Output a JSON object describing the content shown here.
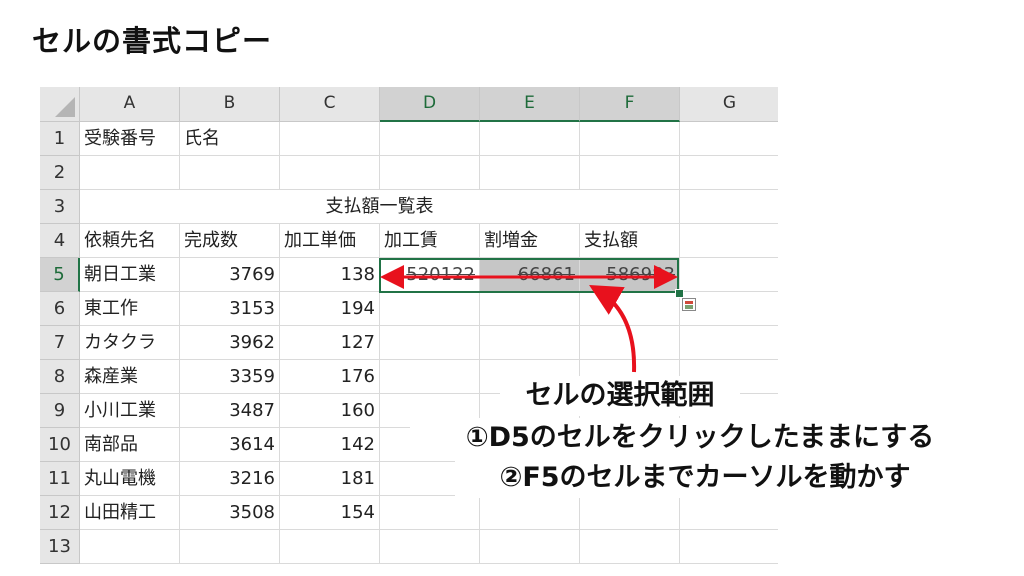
{
  "title": "セルの書式コピー",
  "sheet": {
    "columns": [
      "A",
      "B",
      "C",
      "D",
      "E",
      "F",
      "G"
    ],
    "rows": [
      "1",
      "2",
      "3",
      "4",
      "5",
      "6",
      "7",
      "8",
      "9",
      "10",
      "11",
      "12",
      "13"
    ],
    "selected_columns": [
      "D",
      "E",
      "F"
    ],
    "selected_row": "5",
    "cells": {
      "r1": {
        "A": "受験番号",
        "B": "氏名"
      },
      "r3": {
        "merged": "支払額一覧表"
      },
      "r4": {
        "A": "依頼先名",
        "B": "完成数",
        "C": "加工単価",
        "D": "加工賃",
        "E": "割増金",
        "F": "支払額"
      },
      "r5": {
        "A": "朝日工業",
        "B": "3769",
        "C": "138",
        "D": "520122",
        "E": "66861",
        "F": "586983"
      },
      "r6": {
        "A": "東工作",
        "B": "3153",
        "C": "194"
      },
      "r7": {
        "A": "カタクラ",
        "B": "3962",
        "C": "127"
      },
      "r8": {
        "A": "森産業",
        "B": "3359",
        "C": "176"
      },
      "r9": {
        "A": "小川工業",
        "B": "3487",
        "C": "160"
      },
      "r10": {
        "A": "南部品",
        "B": "3614",
        "C": "142"
      },
      "r11": {
        "A": "丸山電機",
        "B": "3216",
        "C": "181"
      },
      "r12": {
        "A": "山田精工",
        "B": "3508",
        "C": "154"
      }
    }
  },
  "annotations": {
    "heading": "セルの選択範囲",
    "step1": "①D5のセルをクリックしたままにする",
    "step2": "②F5のセルまでカーソルを動かす"
  },
  "colors": {
    "selection_border": "#217346",
    "arrow": "#e8111d",
    "header_bg": "#e6e6e6",
    "selected_fill": "#c6c6c6"
  },
  "icons": [
    "quick-analysis-icon"
  ]
}
